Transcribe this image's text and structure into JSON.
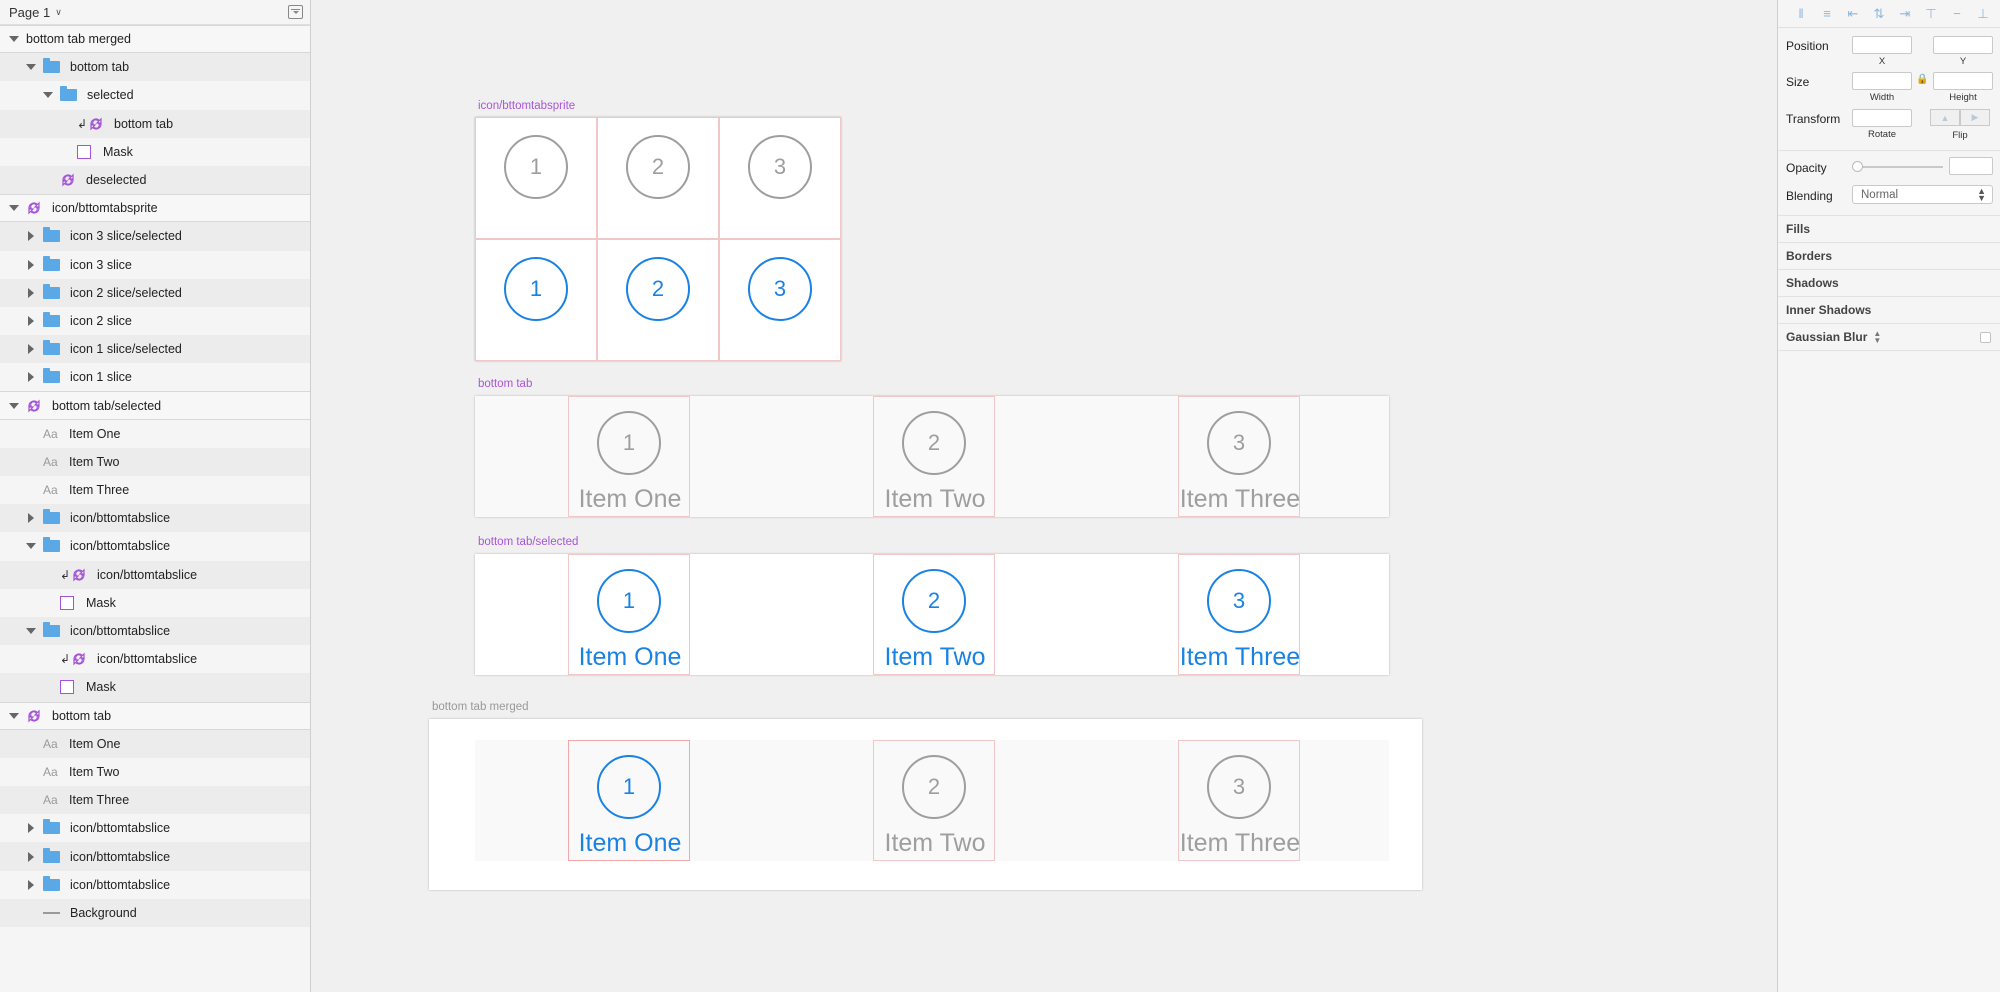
{
  "page_selector": "Page 1",
  "layers": [
    {
      "name": "bottom tab merged",
      "indent": 0,
      "kind": "none",
      "arrow": "down",
      "group": true
    },
    {
      "name": "bottom tab",
      "indent": 1,
      "kind": "folder",
      "arrow": "down"
    },
    {
      "name": "selected",
      "indent": 2,
      "kind": "folder",
      "arrow": "down"
    },
    {
      "name": "bottom tab",
      "indent": 3,
      "kind": "symbol",
      "arrow": "none",
      "masked": true
    },
    {
      "name": "Mask",
      "indent": 3,
      "kind": "mask",
      "arrow": "none"
    },
    {
      "name": "deselected",
      "indent": 2,
      "kind": "symbol",
      "arrow": "none"
    },
    {
      "name": "icon/bttomtabsprite",
      "indent": 0,
      "kind": "symbol",
      "arrow": "down",
      "group": true
    },
    {
      "name": "icon 3 slice/selected",
      "indent": 1,
      "kind": "folder",
      "arrow": "right"
    },
    {
      "name": "icon 3 slice",
      "indent": 1,
      "kind": "folder",
      "arrow": "right"
    },
    {
      "name": "icon 2 slice/selected",
      "indent": 1,
      "kind": "folder",
      "arrow": "right"
    },
    {
      "name": "icon 2 slice",
      "indent": 1,
      "kind": "folder",
      "arrow": "right"
    },
    {
      "name": "icon 1 slice/selected",
      "indent": 1,
      "kind": "folder",
      "arrow": "right"
    },
    {
      "name": "icon 1 slice",
      "indent": 1,
      "kind": "folder",
      "arrow": "right"
    },
    {
      "name": "bottom tab/selected",
      "indent": 0,
      "kind": "symbol",
      "arrow": "down",
      "group": true
    },
    {
      "name": "Item One",
      "indent": 1,
      "kind": "text",
      "arrow": "none"
    },
    {
      "name": "Item Two",
      "indent": 1,
      "kind": "text",
      "arrow": "none"
    },
    {
      "name": "Item Three",
      "indent": 1,
      "kind": "text",
      "arrow": "none"
    },
    {
      "name": "icon/bttomtabslice",
      "indent": 1,
      "kind": "folder",
      "arrow": "right"
    },
    {
      "name": "icon/bttomtabslice",
      "indent": 1,
      "kind": "folder",
      "arrow": "down"
    },
    {
      "name": "icon/bttomtabslice",
      "indent": 2,
      "kind": "symbol",
      "arrow": "none",
      "masked": true
    },
    {
      "name": "Mask",
      "indent": 2,
      "kind": "mask",
      "arrow": "none"
    },
    {
      "name": "icon/bttomtabslice",
      "indent": 1,
      "kind": "folder",
      "arrow": "down"
    },
    {
      "name": "icon/bttomtabslice",
      "indent": 2,
      "kind": "symbol",
      "arrow": "none",
      "masked": true
    },
    {
      "name": "Mask",
      "indent": 2,
      "kind": "mask",
      "arrow": "none"
    },
    {
      "name": "bottom tab",
      "indent": 0,
      "kind": "symbol",
      "arrow": "down",
      "group": true
    },
    {
      "name": "Item One",
      "indent": 1,
      "kind": "text",
      "arrow": "none"
    },
    {
      "name": "Item Two",
      "indent": 1,
      "kind": "text",
      "arrow": "none"
    },
    {
      "name": "Item Three",
      "indent": 1,
      "kind": "text",
      "arrow": "none"
    },
    {
      "name": "icon/bttomtabslice",
      "indent": 1,
      "kind": "folder",
      "arrow": "right"
    },
    {
      "name": "icon/bttomtabslice",
      "indent": 1,
      "kind": "folder",
      "arrow": "right"
    },
    {
      "name": "icon/bttomtabslice",
      "indent": 1,
      "kind": "folder",
      "arrow": "right"
    },
    {
      "name": "Background",
      "indent": 1,
      "kind": "line",
      "arrow": "none"
    }
  ],
  "text_icon": "Aa",
  "inspector": {
    "position_label": "Position",
    "x_label": "X",
    "y_label": "Y",
    "size_label": "Size",
    "width_label": "Width",
    "height_label": "Height",
    "transform_label": "Transform",
    "rotate_label": "Rotate",
    "flip_label": "Flip",
    "opacity_label": "Opacity",
    "blending_label": "Blending",
    "blending_value": "Normal",
    "sections": [
      "Fills",
      "Borders",
      "Shadows",
      "Inner Shadows",
      "Gaussian Blur"
    ]
  },
  "canvas": {
    "sprite_label": "icon/bttomtabsprite",
    "bottom_tab_label": "bottom tab",
    "bottom_tab_selected_label": "bottom tab/selected",
    "merged_label": "bottom tab merged",
    "numbers": [
      "1",
      "2",
      "3"
    ],
    "items": [
      "Item One",
      "Item Two",
      "Item Three"
    ],
    "grey_color": "#9e9e9e",
    "blue_color": "#1a82e2",
    "symbol_label_color": "#a855d8"
  }
}
